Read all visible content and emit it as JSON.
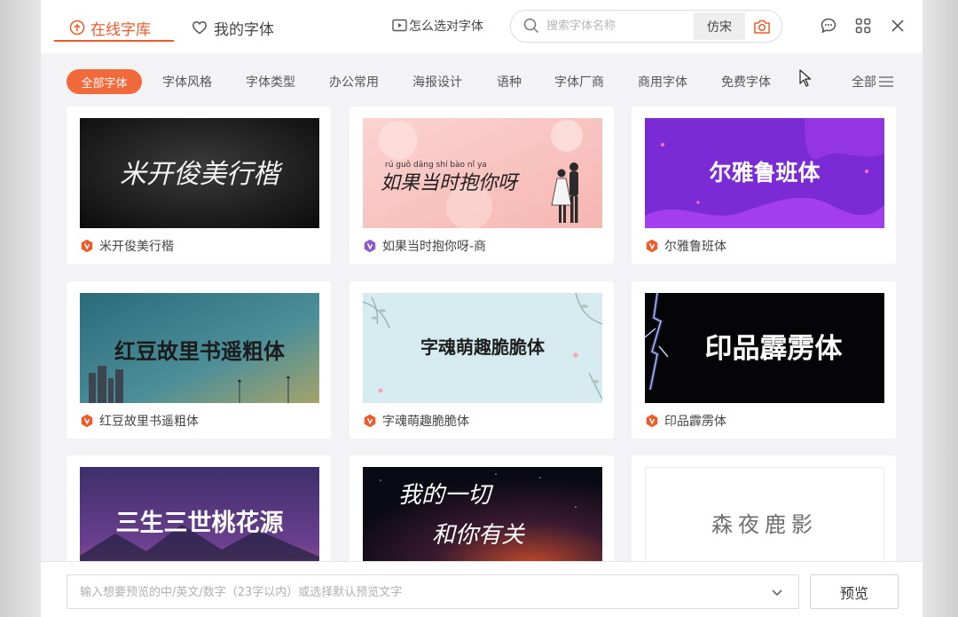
{
  "tabs": {
    "online": "在线字库",
    "mine": "我的字体"
  },
  "help_link": "怎么选对字体",
  "search": {
    "placeholder": "搜索字体名称",
    "current_font": "仿宋"
  },
  "categories": {
    "all": "全部字体",
    "items": [
      "字体风格",
      "字体类型",
      "办公常用",
      "海报设计",
      "语种",
      "字体厂商",
      "商用字体",
      "免费字体"
    ],
    "more": "全部"
  },
  "cards": [
    {
      "name": "米开俊美行楷",
      "thumb_text": "米开俊美行楷",
      "badge": "orange"
    },
    {
      "name": "如果当时抱你呀-商",
      "thumb_text": "如果当时抱你呀",
      "pinyin": "rú guǒ dāng shí bào nǐ ya",
      "badge": "purple"
    },
    {
      "name": "尔雅鲁班体",
      "thumb_text": "尔雅鲁班体",
      "badge": "orange"
    },
    {
      "name": "红豆故里书遥粗体",
      "thumb_text": "红豆故里书遥粗体",
      "badge": "orange"
    },
    {
      "name": "字魂萌趣脆脆体",
      "thumb_text": "字魂萌趣脆脆体",
      "badge": "orange"
    },
    {
      "name": "印品霹雳体",
      "thumb_text": "印品霹雳体",
      "badge": "orange"
    },
    {
      "name": "",
      "thumb_text": "三生三世桃花源",
      "badge": "orange"
    },
    {
      "name": "",
      "thumb_text": "我的一切",
      "thumb_text2": "和你有关",
      "badge": "orange"
    },
    {
      "name": "",
      "thumb_text": "森夜鹿影",
      "badge": "orange"
    }
  ],
  "preview": {
    "placeholder": "输入想要预览的中/英文/数字（23字以内）或选择默认预览文字",
    "button": "预览"
  },
  "colors": {
    "accent": "#f05a28",
    "badge_orange": "#f05a28",
    "badge_purple": "#8b5cc7"
  }
}
